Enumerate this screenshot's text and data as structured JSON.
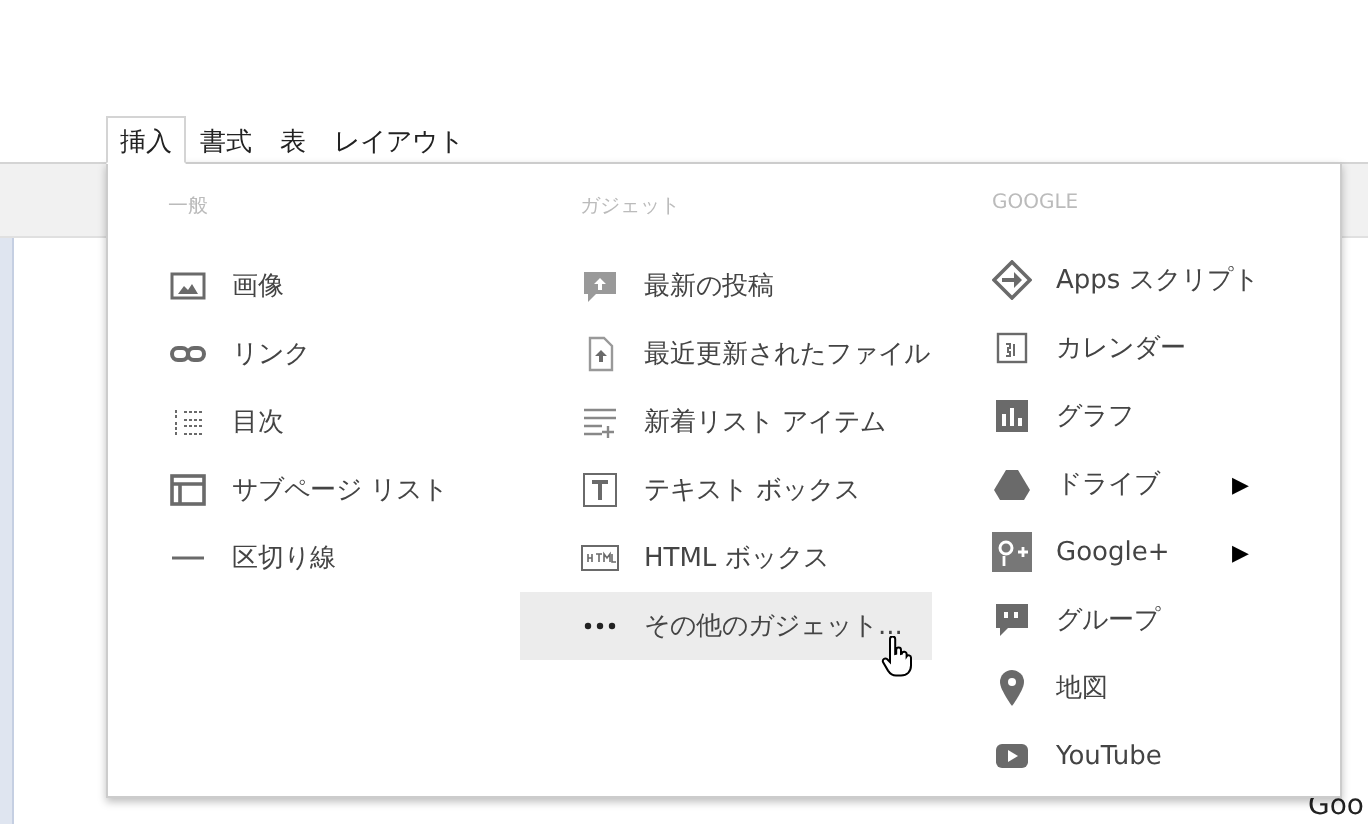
{
  "menu_bar": [
    {
      "label": "挿入",
      "selected": true
    },
    {
      "label": "書式",
      "selected": false
    },
    {
      "label": "表",
      "selected": false
    },
    {
      "label": "レイアウト",
      "selected": false
    }
  ],
  "page_fragment": "Goo",
  "dropdown": {
    "columns": [
      {
        "heading": "一般",
        "items": [
          {
            "label": "画像",
            "highlighted": false
          },
          {
            "label": "リンク",
            "highlighted": false
          },
          {
            "label": "目次",
            "highlighted": false
          },
          {
            "label": "サブページ リスト",
            "highlighted": false
          },
          {
            "label": "区切り線",
            "highlighted": false
          }
        ]
      },
      {
        "heading": "ガジェット",
        "items": [
          {
            "label": "最新の投稿",
            "highlighted": false
          },
          {
            "label": "最近更新されたファイル",
            "highlighted": false
          },
          {
            "label": "新着リスト アイテム",
            "highlighted": false
          },
          {
            "label": "テキスト ボックス",
            "highlighted": false
          },
          {
            "label": "HTML ボックス",
            "highlighted": false
          },
          {
            "label": "その他のガジェット...",
            "highlighted": true
          }
        ]
      },
      {
        "heading": "GOOGLE",
        "items": [
          {
            "label": "Apps スクリプト",
            "highlighted": false
          },
          {
            "label": "カレンダー",
            "highlighted": false
          },
          {
            "label": "グラフ",
            "highlighted": false
          },
          {
            "label": "ドライブ",
            "highlighted": false,
            "arrow": "▶"
          },
          {
            "label": "Google+",
            "highlighted": false,
            "arrow": "▶"
          },
          {
            "label": "グループ",
            "highlighted": false
          },
          {
            "label": "地図",
            "highlighted": false
          },
          {
            "label": "YouTube",
            "highlighted": false
          }
        ]
      }
    ]
  }
}
